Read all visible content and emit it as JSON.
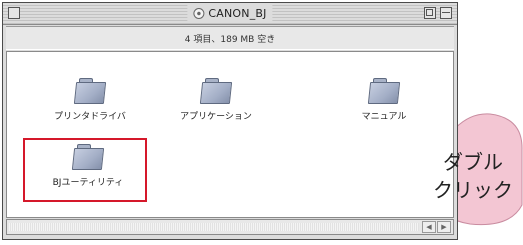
{
  "window": {
    "title": "CANON_BJ",
    "info": "4 項目、189 MB 空き"
  },
  "icons": [
    {
      "label": "プリンタドライバ",
      "icon": "folder-icon"
    },
    {
      "label": "アプリケーション",
      "icon": "folder-icon"
    },
    {
      "label": "マニュアル",
      "icon": "folder-icon"
    },
    {
      "label": "BJユーティリティ",
      "icon": "folder-icon"
    }
  ],
  "callout": {
    "line1": "ダブル",
    "line2": "クリック"
  },
  "colors": {
    "highlight": "#d5182a",
    "callout_fill": "#f3c6d3"
  }
}
